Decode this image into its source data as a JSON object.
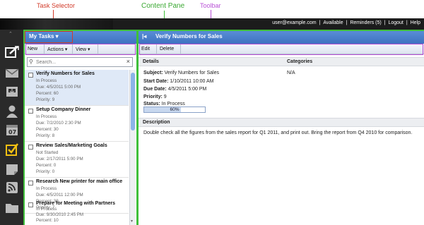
{
  "annotations": {
    "task_selector": "Task Selector",
    "content_pane": "Content Pane",
    "toolbar": "Toolbar"
  },
  "topbar": {
    "user": "user@example.com",
    "available": "Available",
    "reminders": "Reminders (5)",
    "logout": "Logout",
    "help": "Help",
    "separator": "|"
  },
  "rail": {
    "icons": [
      "compose-icon",
      "mail-icon",
      "inbox-icon",
      "contacts-icon",
      "calendar-icon",
      "tasks-icon",
      "notes-icon",
      "rss-icon",
      "folder-icon"
    ]
  },
  "task_pane": {
    "selector_label": "My Tasks ▾",
    "toolbar": {
      "new": "New",
      "actions": "Actions ▾",
      "view": "View ▾"
    },
    "search_placeholder": "Search...",
    "tasks": [
      {
        "title": "Verify Numbers for Sales",
        "status": "In Process",
        "due": "Due: 4/5/2011 5:00 PM",
        "percent": "Percent: 60",
        "priority": "Priority: 9",
        "selected": true
      },
      {
        "title": "Setup Company Dinner",
        "status": "In Process",
        "due": "Due: 7/2/2010 2:30 PM",
        "percent": "Percent: 30",
        "priority": "Priority: 8",
        "selected": false
      },
      {
        "title": "Review Sales/Marketing Goals",
        "status": "Not Started",
        "due": "Due: 2/17/2011 5:00 PM",
        "percent": "Percent: 0",
        "priority": "Priority: 0",
        "selected": false
      },
      {
        "title": "Research New printer for main office",
        "status": "In Process",
        "due": "Due: 4/5/2011 12:00 PM",
        "percent": "Percent: 30",
        "priority": "Priority: 7",
        "selected": false
      },
      {
        "title": "Prepare for Meeting with Partners",
        "status": "In Process",
        "due": "Due: 9/30/2010 2:45 PM",
        "percent": "Percent: 10",
        "priority": "",
        "selected": false
      }
    ]
  },
  "content_pane": {
    "collapse_glyph": "|◂",
    "title": "Verify Numbers for Sales",
    "toolbar": {
      "edit": "Edit",
      "delete": "Delete"
    },
    "details_heading": "Details",
    "categories_heading": "Categories",
    "categories_value": "N/A",
    "fields": {
      "subject_label": "Subject:",
      "subject_value": "Verify Numbers for Sales",
      "start_label": "Start Date:",
      "start_value": "1/10/2011 10:00 AM",
      "due_label": "Due Date:",
      "due_value": "4/5/2011 5:00 PM",
      "priority_label": "Priority:",
      "priority_value": "9",
      "status_label": "Status:",
      "status_value": "In Process"
    },
    "progress": {
      "value": 0.6,
      "label": "60%"
    },
    "description_heading": "Description",
    "description": "Double check all the figures from the sales report for Q1 2011, and print out. Bring the report from Q4 2010 for comparison."
  },
  "colors": {
    "header_blue": "#4a7fcb",
    "annotation_red": "#d23b2a",
    "annotation_green": "#3fbf3a",
    "annotation_purple": "#b84fd6"
  }
}
